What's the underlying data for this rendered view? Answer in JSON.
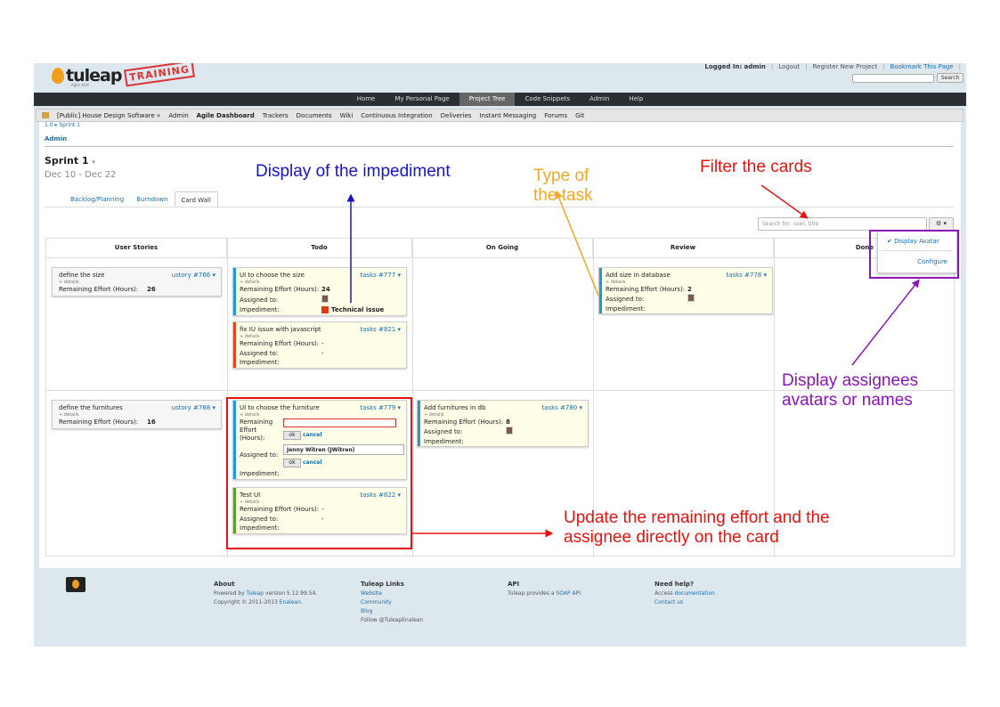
{
  "header": {
    "logo_text": "tuleap",
    "logo_sub": "Agile ALM",
    "stamp": "TRAINING",
    "logged_in_label": "Logged In:",
    "user": "admin",
    "logout": "Logout",
    "register": "Register New Project",
    "bookmark": "Bookmark This Page",
    "search_button": "Search"
  },
  "topnav": [
    "Home",
    "My Personal Page",
    "Project Tree",
    "Code Snippets",
    "Admin",
    "Help"
  ],
  "projnav": {
    "project": "[Public] House Design Software »",
    "items": [
      "Admin",
      "Agile Dashboard",
      "Trackers",
      "Documents",
      "Wiki",
      "Continuous Integration",
      "Deliveries",
      "Instant Messaging",
      "Forums",
      "Git"
    ]
  },
  "page": {
    "breadcrumb": "1.0  ▸  Sprint 1",
    "admin_link": "Admin",
    "sprint_title": "Sprint 1",
    "sprint_dates": "Dec 10 - Dec 22",
    "tabs": [
      "Backlog/Planning",
      "Burndown",
      "Card Wall"
    ],
    "filter_placeholder": "Search for: user, title",
    "gear": "⚙ ▾",
    "dropdown": {
      "display_avatar": "✔ Display Avatar",
      "configure": "Configure"
    }
  },
  "board": {
    "columns": [
      "User Stories",
      "Todo",
      "On Going",
      "Review",
      "Done"
    ],
    "details": "+ details",
    "remaining_label": "Remaining Effort (Hours):",
    "assigned_label": "Assigned to:",
    "impediment_label": "Impediment:",
    "stories": [
      {
        "title": "define the size",
        "id": "ustory #766 ▾",
        "effort": "26"
      },
      {
        "title": "define the furnitures",
        "id": "ustory #768 ▾",
        "effort": "16"
      }
    ],
    "tasks": {
      "t777": {
        "title": "UI to choose the size",
        "id": "tasks #777 ▾",
        "effort": "24",
        "impediment": "Technical issue"
      },
      "t821": {
        "title": "fix IU issue with javascript",
        "id": "tasks #821 ▾",
        "effort": "-",
        "assigned": "-"
      },
      "t778": {
        "title": "Add size in database",
        "id": "tasks #778 ▾",
        "effort": "2"
      },
      "t779": {
        "title": "UI to choose the furniture",
        "id": "tasks #779 ▾",
        "remaining_lines": [
          "Remaining",
          "Effort",
          "(Hours):"
        ],
        "ok": "ok",
        "cancel": "cancel",
        "assignee": "Jenny Witren (JWitren)"
      },
      "t780": {
        "title": "Add furnitures in db",
        "id": "tasks #780 ▾",
        "effort": "8"
      },
      "t822": {
        "title": "Test UI",
        "id": "tasks #822 ▾",
        "effort": "-",
        "assigned": "-"
      }
    }
  },
  "footer": {
    "about_title": "About",
    "about_line1_a": "Powered by",
    "about_line1_link": "Tuleap",
    "about_line1_b": "version 5.12.99.54.",
    "about_line2_a": "Copyright © 2011-2013",
    "about_line2_link": "Enalean.",
    "links_title": "Tuleap Links",
    "links": [
      "Website",
      "Community",
      "Blog"
    ],
    "follow": "Follow @TuleapEnalean",
    "api_title": "API",
    "api_a": "Tuleap provides a",
    "api_link": "SOAP API.",
    "help_title": "Need help?",
    "help_a": "Access",
    "help_link": "documentation",
    "contact": "Contact us"
  },
  "annotations": {
    "impediment": "Display of the impediment",
    "type_line1": "Type of",
    "type_line2": "the task",
    "filter": "Filter the cards",
    "avatars_line1": "Display assignees",
    "avatars_line2": "avatars or names",
    "update_line1": "Update the remaining effort and the",
    "update_line2": "assignee directly on the card",
    "colors": {
      "blue": "#1414d2",
      "orange": "#f5a623",
      "red": "#e8110e",
      "purple": "#8a15b8"
    }
  }
}
